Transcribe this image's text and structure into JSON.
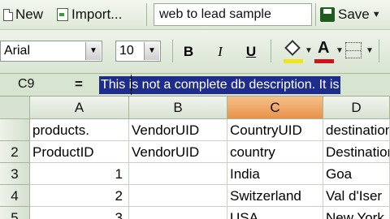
{
  "toolbar": {
    "new_label": "New",
    "import_label": "Import...",
    "filename": "web to lead sample",
    "save_label": "Save"
  },
  "format": {
    "font_name": "Arial",
    "font_size": "10",
    "bold": "B",
    "italic": "I",
    "underline": "U",
    "font_color_glyph": "A",
    "colors": {
      "fill": "#f1e41a",
      "font": "#d0121a",
      "selected_col": "#e8924a",
      "highlight": "#1e2c8c"
    }
  },
  "formula": {
    "cell_ref": "C9",
    "equals": "=",
    "value": "This is not a complete db description. It is"
  },
  "grid": {
    "columns": [
      "A",
      "B",
      "C",
      "D"
    ],
    "selected_column": "C",
    "rows": [
      {
        "num": "",
        "cells": [
          "products.",
          "VendorUID",
          "CountryUID",
          "destination"
        ]
      },
      {
        "num": "2",
        "cells": [
          "ProductID",
          "VendorUID",
          "country",
          "Destination"
        ]
      },
      {
        "num": "3",
        "cells": [
          "1",
          "",
          "India",
          "Goa"
        ]
      },
      {
        "num": "4",
        "cells": [
          "2",
          "",
          "Switzerland",
          "Val d'Iser"
        ]
      },
      {
        "num": "5",
        "cells": [
          "3",
          "",
          "USA",
          "New York"
        ]
      }
    ]
  }
}
